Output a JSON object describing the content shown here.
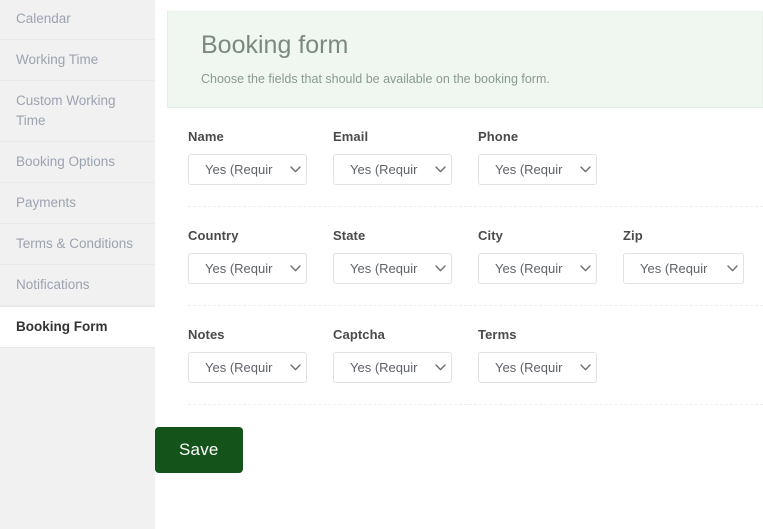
{
  "sidebar": {
    "items": [
      {
        "label": "Calendar",
        "active": false
      },
      {
        "label": "Working Time",
        "active": false
      },
      {
        "label": "Custom Working Time",
        "active": false
      },
      {
        "label": "Booking Options",
        "active": false
      },
      {
        "label": "Payments",
        "active": false
      },
      {
        "label": "Terms & Conditions",
        "active": false
      },
      {
        "label": "Notifications",
        "active": false
      },
      {
        "label": "Booking Form",
        "active": true
      }
    ]
  },
  "header": {
    "title": "Booking form",
    "subtitle": "Choose the fields that should be available on the booking form.",
    "background_color": "#f0f7f1"
  },
  "form": {
    "rows": [
      {
        "fields": [
          {
            "label": "Name",
            "value": "Yes (Requir"
          },
          {
            "label": "Email",
            "value": "Yes (Requir"
          },
          {
            "label": "Phone",
            "value": "Yes (Requir"
          }
        ]
      },
      {
        "fields": [
          {
            "label": "Country",
            "value": "Yes (Requir"
          },
          {
            "label": "State",
            "value": "Yes (Requir"
          },
          {
            "label": "City",
            "value": "Yes (Requir"
          },
          {
            "label": "Zip",
            "value": "Yes (Requir"
          }
        ]
      },
      {
        "fields": [
          {
            "label": "Notes",
            "value": "Yes (Requir"
          },
          {
            "label": "Captcha",
            "value": "Yes (Requir"
          },
          {
            "label": "Terms",
            "value": "Yes (Requir"
          }
        ]
      }
    ],
    "caret_icon": "chevron-down-icon"
  },
  "actions": {
    "save_label": "Save",
    "save_color": "#14541a"
  }
}
